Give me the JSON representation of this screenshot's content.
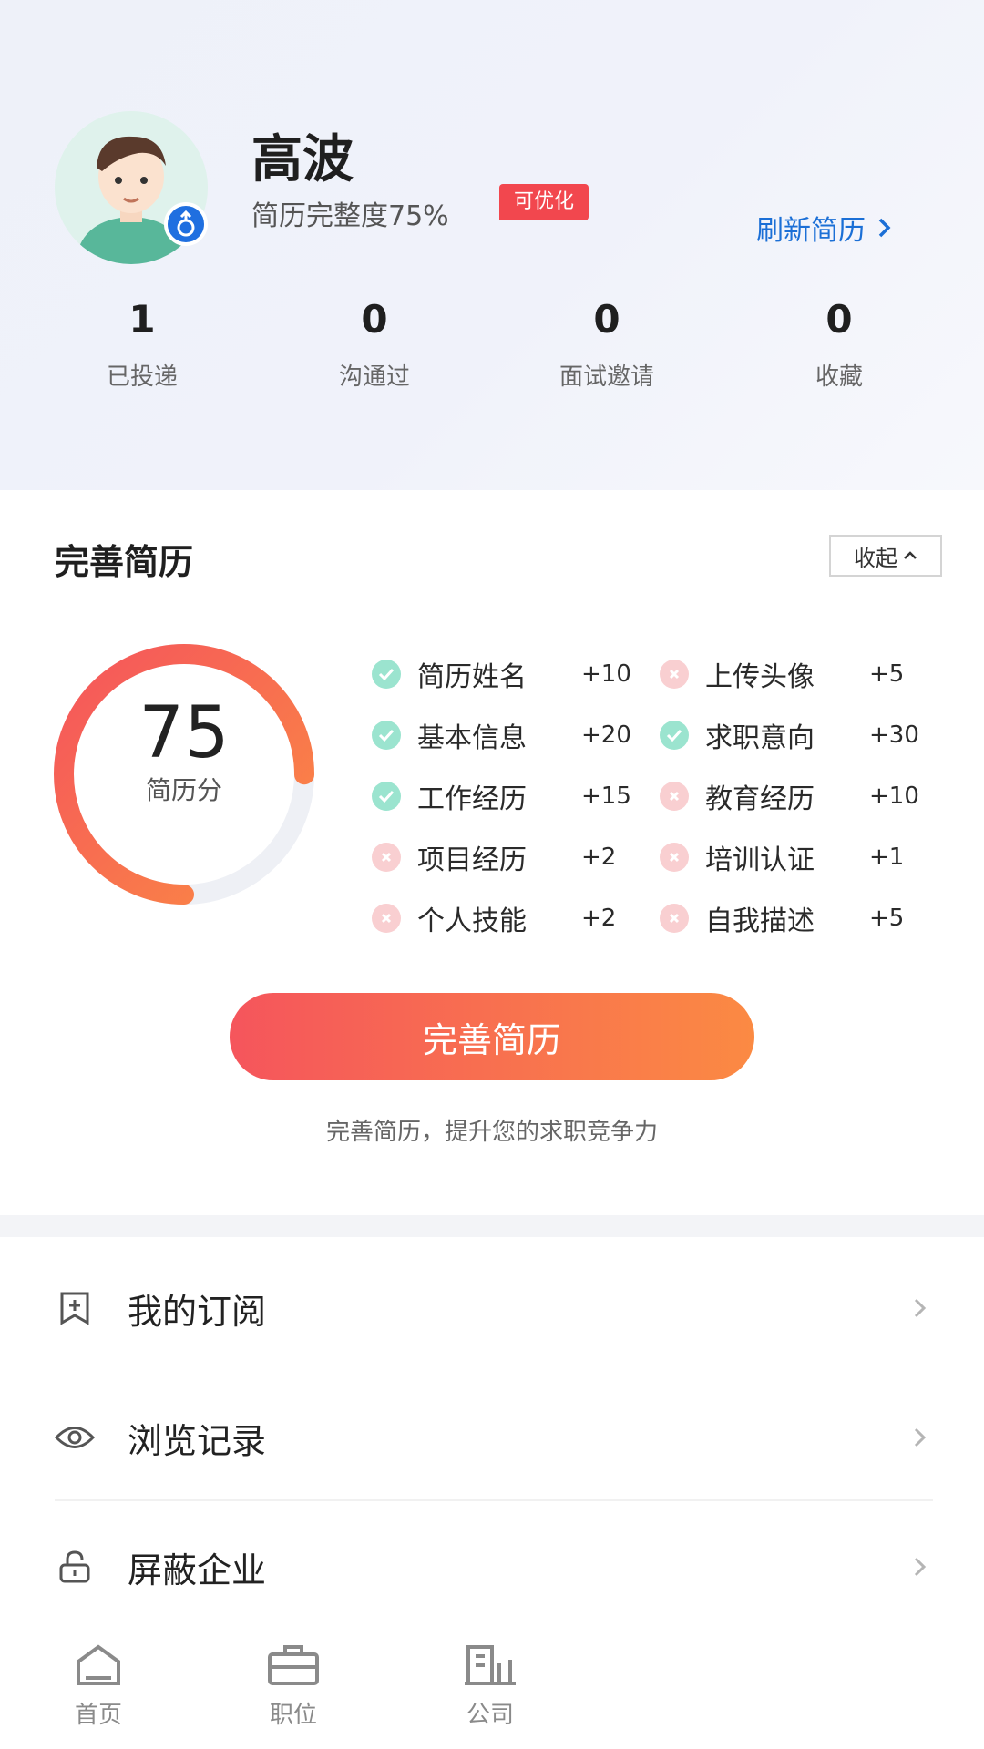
{
  "profile": {
    "name": "高波",
    "completeness": "简历完整度75%",
    "optimize_badge": "可优化",
    "refresh_label": "刷新简历"
  },
  "stats": [
    {
      "value": "1",
      "label": "已投递"
    },
    {
      "value": "0",
      "label": "沟通过"
    },
    {
      "value": "0",
      "label": "面试邀请"
    },
    {
      "value": "0",
      "label": "收藏"
    }
  ],
  "resume_card": {
    "title": "完善简历",
    "collapse_label": "收起",
    "score": "75",
    "score_label": "简历分",
    "score_fraction": 0.75,
    "items": [
      {
        "name": "简历姓名",
        "points": "+10",
        "done": true
      },
      {
        "name": "上传头像",
        "points": "+5",
        "done": false
      },
      {
        "name": "基本信息",
        "points": "+20",
        "done": true
      },
      {
        "name": "求职意向",
        "points": "+30",
        "done": true
      },
      {
        "name": "工作经历",
        "points": "+15",
        "done": true
      },
      {
        "name": "教育经历",
        "points": "+10",
        "done": false
      },
      {
        "name": "项目经历",
        "points": "+2",
        "done": false
      },
      {
        "name": "培训认证",
        "points": "+1",
        "done": false
      },
      {
        "name": "个人技能",
        "points": "+2",
        "done": false
      },
      {
        "name": "自我描述",
        "points": "+5",
        "done": false
      }
    ],
    "button_label": "完善简历",
    "tip": "完善简历，提升您的求职竞争力"
  },
  "menu": [
    {
      "label": "我的订阅",
      "icon": "bookmark-plus-icon"
    },
    {
      "label": "浏览记录",
      "icon": "eye-icon"
    },
    {
      "label": "屏蔽企业",
      "icon": "lock-icon"
    }
  ],
  "nav": [
    {
      "label": "首页",
      "icon": "home-icon"
    },
    {
      "label": "职位",
      "icon": "briefcase-icon"
    },
    {
      "label": "公司",
      "icon": "building-icon"
    }
  ],
  "colors": {
    "accent_blue": "#1b6fd6",
    "badge_red": "#f2474e",
    "gradient_start": "#f5555c",
    "gradient_end": "#fb8a43",
    "check_green": "#9be4cf",
    "cross_pink": "#f9cfd1"
  }
}
